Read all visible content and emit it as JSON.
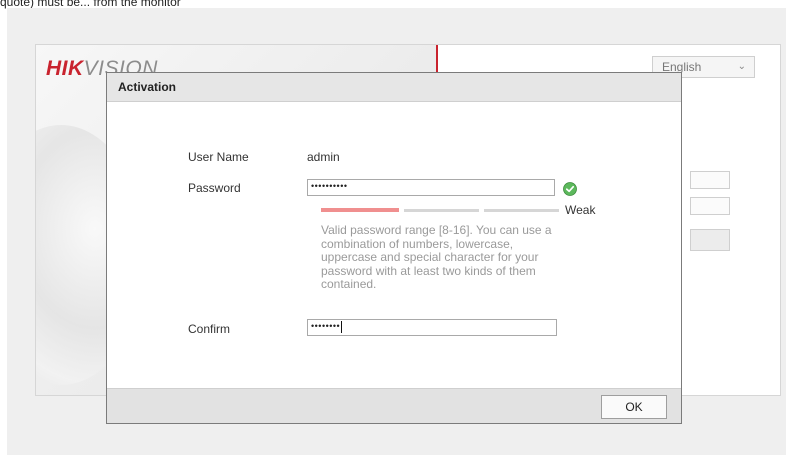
{
  "caption": "quote, ",
  "caption_full": "quote) must be... from the monitor",
  "brand": {
    "logo_red": "HIK",
    "logo_gray": "VISION"
  },
  "language": {
    "selected": "English"
  },
  "dialog": {
    "title": "Activation",
    "user_name_label": "User Name",
    "user_name_value": "admin",
    "password_label": "Password",
    "password_value": "••••••••••",
    "strength_label": "Weak",
    "strength_level": 1,
    "strength_levels_total": 3,
    "hint": "Valid password range [8-16]. You can use a combination of numbers, lowercase, uppercase and special character for your password with at least two kinds of them contained.",
    "confirm_label": "Confirm",
    "confirm_value": "••••••••",
    "ok_label": "OK"
  },
  "colors": {
    "brand_red": "#c9232e",
    "weak_bar": "#f08f8f",
    "valid_green": "#4caf50"
  },
  "icons": {
    "password_valid": "check-circle-icon",
    "language_dropdown": "chevron-down-icon"
  }
}
